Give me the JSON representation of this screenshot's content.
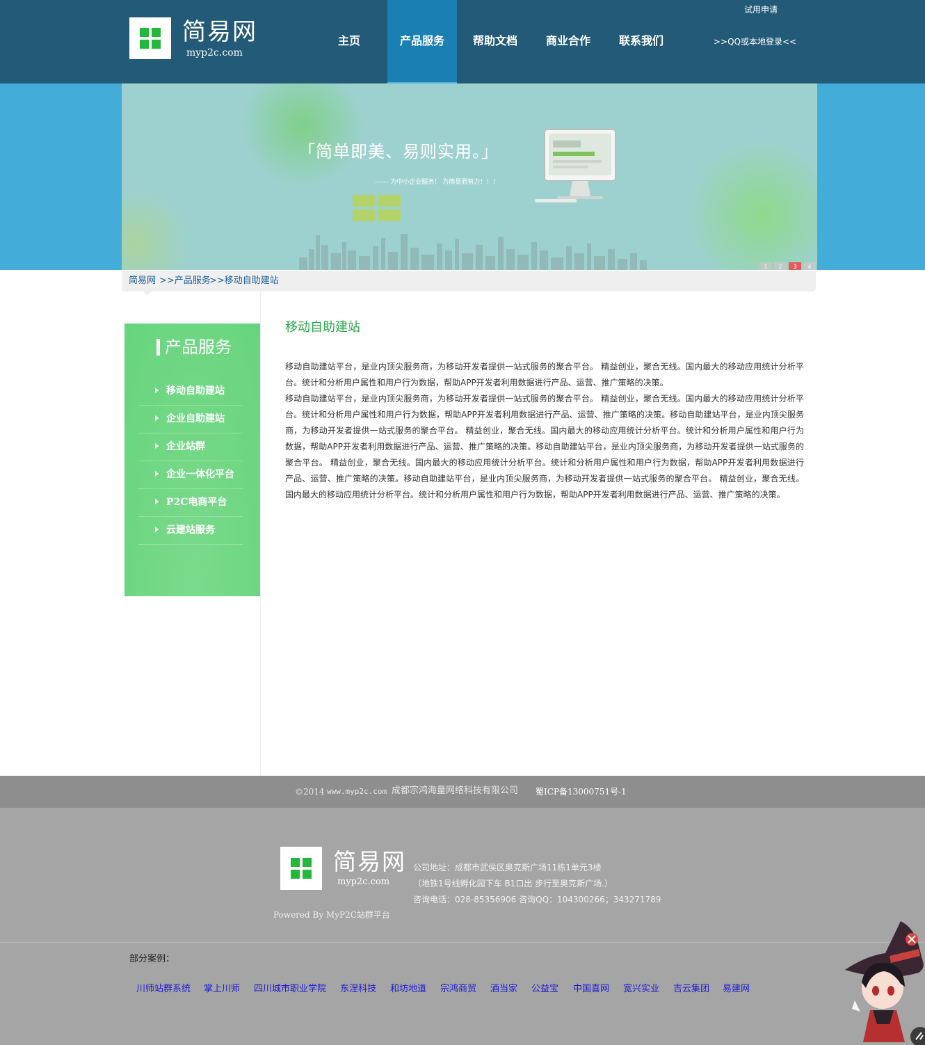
{
  "header": {
    "logo_name": "简易网",
    "logo_domain": "myp2c.com",
    "nav": [
      "主页",
      "产品服务",
      "帮助文档",
      "商业合作",
      "联系我们"
    ],
    "active_nav": "产品服务",
    "trial_link": "试用申请",
    "login_link": ">>QQ或本地登录<<"
  },
  "banner": {
    "slogan": "「简单即美、易则实用。」",
    "sub_slogan": "------ 为中小企业服务！ 为简易而努力！！！",
    "pages": [
      "1",
      "2",
      "3",
      "4"
    ],
    "active_page": "3"
  },
  "breadcrumb": {
    "home": "简易网",
    "section": ">>产品服务",
    "current": ">>移动自助建站"
  },
  "sidebar": {
    "title": "产品服务",
    "items": [
      "移动自助建站",
      "企业自助建站",
      "企业站群",
      "企业一体化平台",
      "P2C电商平台",
      "云建站服务"
    ]
  },
  "content": {
    "title": "移动自助建站",
    "paragraphs": [
      "移动自助建站平台，是业内顶尖服务商，为移动开发者提供一站式服务的聚合平台。 精益创业，聚合无线。国内最大的移动应用统计分析平台。统计和分析用户属性和用户行为数据，帮助APP开发者利用数据进行产品、运营、推广策略的决策。",
      "移动自助建站平台，是业内顶尖服务商，为移动开发者提供一站式服务的聚合平台。 精益创业，聚合无线。国内最大的移动应用统计分析平台。统计和分析用户属性和用户行为数据，帮助APP开发者利用数据进行产品、运营、推广策略的决策。移动自助建站平台，是业内顶尖服务商，为移动开发者提供一站式服务的聚合平台。 精益创业，聚合无线。国内最大的移动应用统计分析平台。统计和分析用户属性和用户行为数据，帮助APP开发者利用数据进行产品、运营、推广策略的决策。移动自助建站平台，是业内顶尖服务商，为移动开发者提供一站式服务的聚合平台。 精益创业，聚合无线。国内最大的移动应用统计分析平台。统计和分析用户属性和用户行为数据，帮助APP开发者利用数据进行产品、运营、推广策略的决策。移动自助建站平台，是业内顶尖服务商，为移动开发者提供一站式服务的聚合平台。 精益创业，聚合无线。国内最大的移动应用统计分析平台。统计和分析用户属性和用户行为数据，帮助APP开发者利用数据进行产品、运营、推广策略的决策。"
    ]
  },
  "footer": {
    "copyright": "©2014",
    "site": "www.myp2c.com",
    "company": "成都宗鸿海量网络科技有限公司",
    "icp": "蜀ICP备13000751号-1",
    "logo_name": "简易网",
    "logo_domain": "myp2c.com",
    "address": "公司地址：成都市武侯区奥克斯广场11栋1单元3楼",
    "directions": "（地铁1号线孵化园下车 B1口出 步行至奥克斯广场.）",
    "contact": "咨询电话：028-85356906 咨询QQ：104300266；343271789",
    "powered": "Powered By MyP2C站群平台",
    "cases_label": "部分案例：",
    "cases": [
      "川师站群系统",
      "掌上川师",
      "四川城市职业学院",
      "东涅科技",
      "和坊地道",
      "宗鸿商贸",
      "酒当家",
      "公益宝",
      "中国喜网",
      "宽兴实业",
      "吉云集团",
      "易建网"
    ]
  },
  "colors": {
    "header_bg": "#235a78",
    "nav_active": "#1a7fb3",
    "banner_bg": "#43acd8",
    "sidebar_green": "#66d47c",
    "title_green": "#2aa84a",
    "link_blue": "#1a1ad6",
    "logo_green": "#22b83a"
  }
}
